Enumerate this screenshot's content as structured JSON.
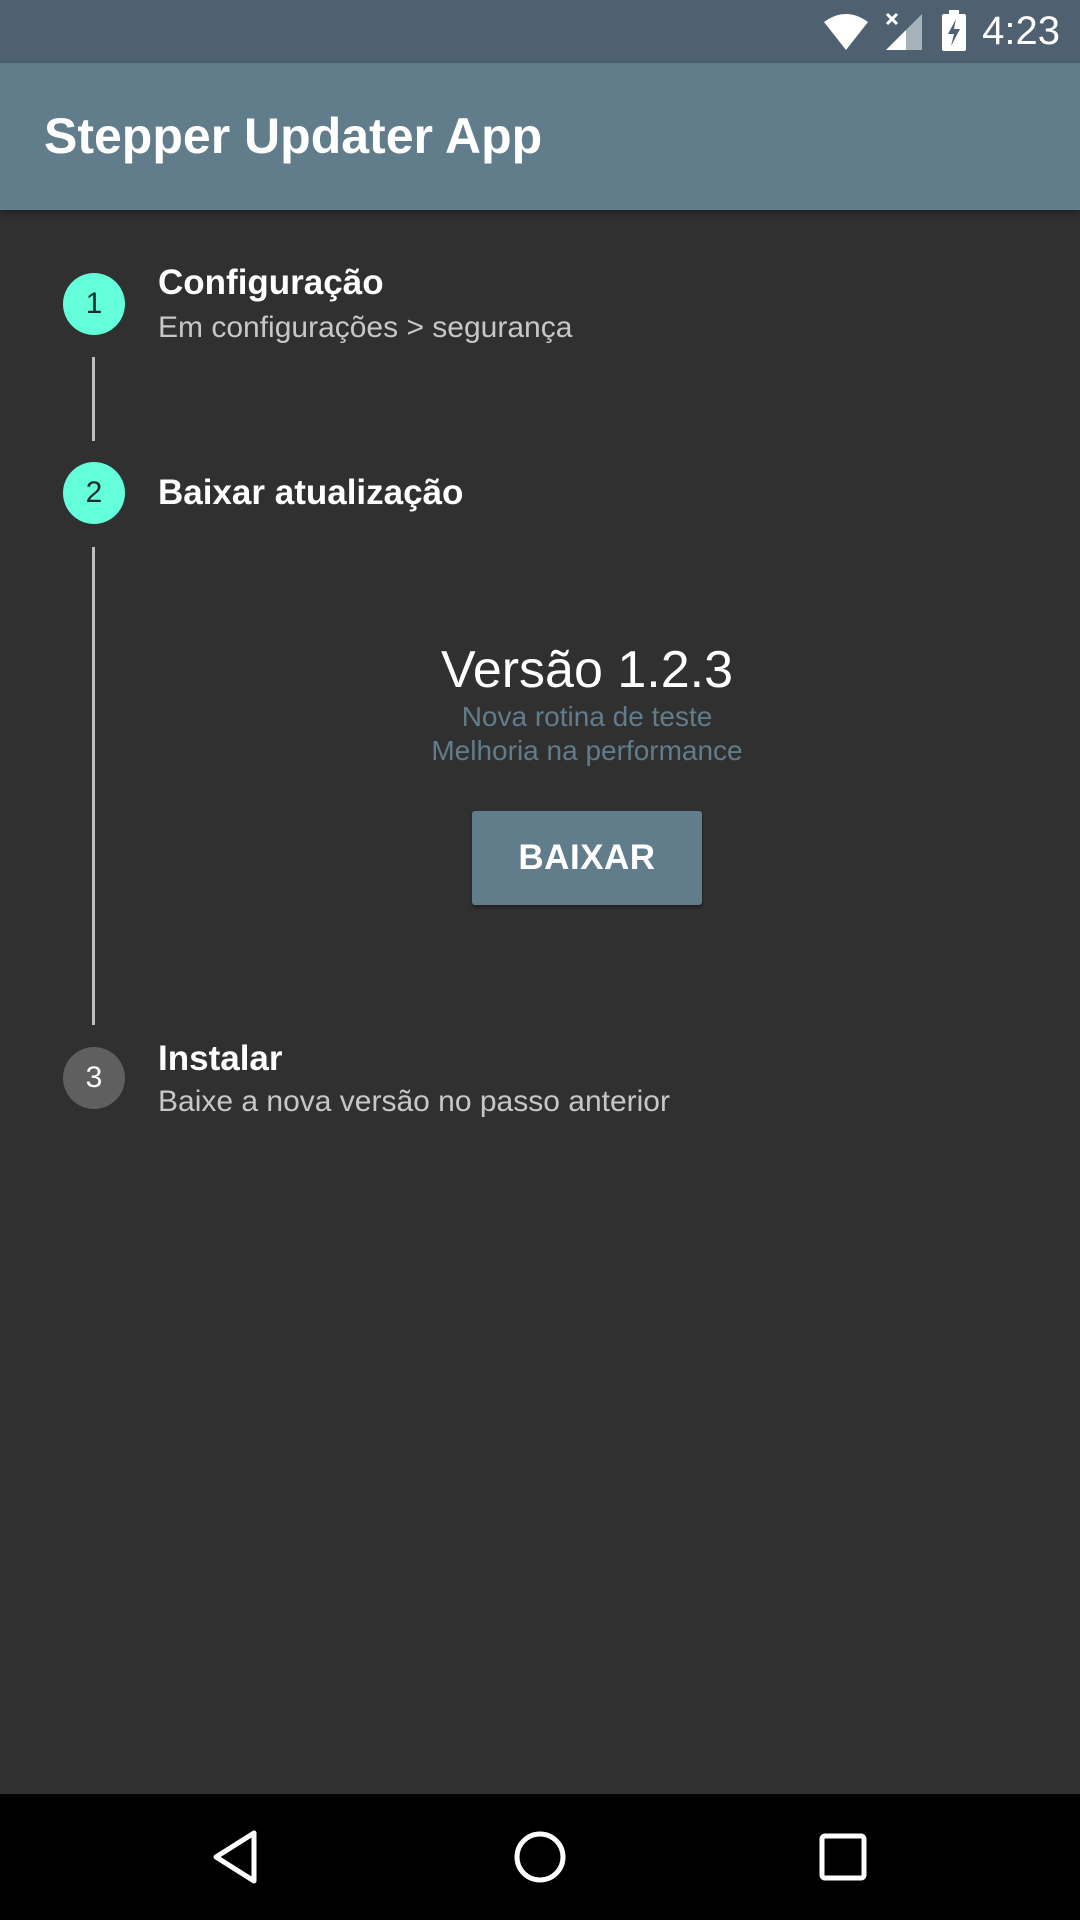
{
  "status_bar": {
    "time": "4:23",
    "icons": [
      "wifi-icon",
      "signal-icon",
      "battery-charging-icon"
    ],
    "color": "#4f6170"
  },
  "app_bar": {
    "title": "Stepper Updater App",
    "color": "#617d8b"
  },
  "stepper": {
    "active_color": "#64ffda",
    "inactive_color": "#5f5f5f",
    "steps": [
      {
        "number": "1",
        "title": "Configuração",
        "subtitle": "Em configurações > segurança",
        "state": "active"
      },
      {
        "number": "2",
        "title": "Baixar atualização",
        "subtitle": "",
        "state": "active"
      },
      {
        "number": "3",
        "title": "Instalar",
        "subtitle": "Baixe a nova versão no passo anterior",
        "state": "inactive"
      }
    ]
  },
  "update": {
    "version": "Versão 1.2.3",
    "notes": [
      "Nova rotina de teste",
      "Melhoria na performance"
    ],
    "button_label": "BAIXAR"
  },
  "nav_bar": {
    "buttons": [
      "back-icon",
      "home-icon",
      "recents-icon"
    ]
  }
}
